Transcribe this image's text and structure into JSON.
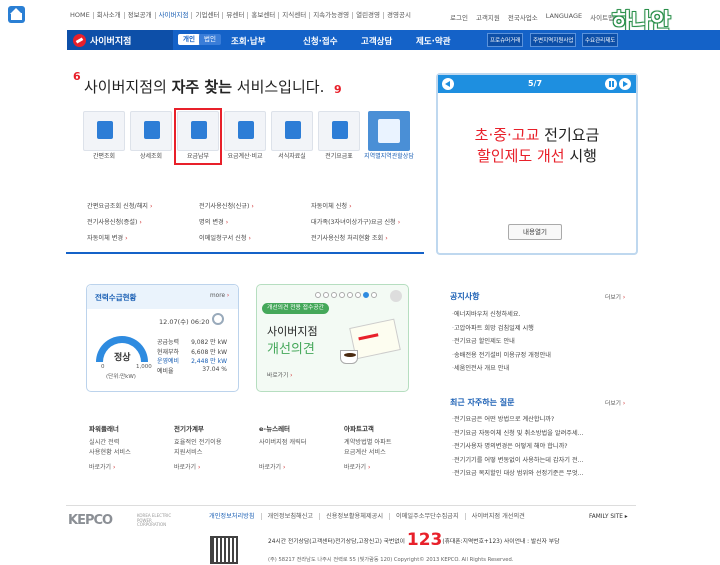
{
  "top_nav": [
    "HOME",
    "회사소개",
    "정보공개",
    "사이버지점",
    "기업센터",
    "뮤센터",
    "홍보센터",
    "지식센터",
    "지속가능경영",
    "열린경영",
    "경영공시"
  ],
  "top_nav_active": "사이버지점",
  "util_nav": [
    "로그인",
    "고객지원",
    "전국사업소",
    "LANGUAGE",
    "사이트맵"
  ],
  "brand_deco": "하나안",
  "gnb": {
    "title": "사이버지점",
    "personal": "개인",
    "corporate": "법인",
    "menu": [
      "조회·납부",
      "신청·접수",
      "고객상담",
      "제도·약관"
    ],
    "quick": [
      "프로슈머거래",
      "주변지역지원사업",
      "수요관리제도"
    ]
  },
  "frequent": {
    "title_prefix": "사이버지점의 ",
    "title_bold": "자주 찾는",
    "title_suffix": " 서비스입니다.",
    "deco_left": "6",
    "deco_right": "9",
    "services": [
      {
        "label": "간편조회",
        "icon": "bill-chart-icon",
        "color": "#2d7dd6"
      },
      {
        "label": "상세조회",
        "icon": "magnify-plus-icon",
        "color": "#2d7dd6"
      },
      {
        "label": "요금납부",
        "icon": "payment-book-icon",
        "color": "#2d7dd6"
      },
      {
        "label": "요금계산·비교",
        "icon": "calendar-calc-icon",
        "color": "#2d7dd6"
      },
      {
        "label": "서식자료실",
        "icon": "document-list-icon",
        "color": "#2d7dd6"
      },
      {
        "label": "전기요금표",
        "icon": "rate-table-icon",
        "color": "#2d7dd6"
      }
    ],
    "big_label": "지역별지역관할상담"
  },
  "quick_links": [
    [
      "간편요금조회 신청/해지",
      "전기사용신청(신규)",
      "자동이체 신청"
    ],
    [
      "전기사용신청(증설)",
      "명의 변경",
      "대가족(3자녀이상가구)요금 신청"
    ],
    [
      "자동이체 변경",
      "이메일청구서 신청",
      "전기사용신청 처리현황 조회"
    ]
  ],
  "promo": {
    "page": "5/7",
    "line1_red": "초·중·고교",
    "line1_rest": " 전기요금",
    "line2_red": "할인제도 개선",
    "line2_rest": " 시행",
    "button": "내용열기"
  },
  "power": {
    "title": "전력수급현황",
    "more": "more",
    "time": "12.07(수) 06:20",
    "state": "정상",
    "min": "0",
    "max": "1,000",
    "unit": "(단위:만kW)",
    "rows": [
      {
        "label": "공급능력",
        "value": "9,082 만 kW",
        "hl": false
      },
      {
        "label": "현재부하",
        "value": "6,608 만 kW",
        "hl": false
      },
      {
        "label": "운영예비",
        "value": "2,448 만 kW",
        "hl": true
      },
      {
        "label": "예비율",
        "value": "37.04 %",
        "hl": false
      }
    ]
  },
  "cyber_promo": {
    "pill": "개선의견 전용 접수공간",
    "title1": "사이버지점",
    "title2": "개선의견",
    "more": "바로가기"
  },
  "notices": {
    "title": "공지사항",
    "more": "더보기",
    "items": [
      "에너지바우처 신청하세요.",
      "고압아파트 희망 검침일제 시행",
      "전기요금 할인제도 안내",
      "송배전용 전기설비 이용규정 개정안내",
      "세움인전사 개요 안내"
    ]
  },
  "faq": {
    "title": "최근 자주하는 질문",
    "more": "더보기",
    "items": [
      "전기요금은 어떤 방법으로 계산합니까?",
      "전기요금 자동이체 신청 및 취소방법을 알려주세...",
      "전기사용자 명의변경은 어떻게 해야 합니까?",
      "전기기기를 어떻 변동없이 사용하는데 갑자기 전...",
      "전기요금 복지할인 대상 범위와 선정기준은 무엇..."
    ]
  },
  "columns": [
    {
      "title": "파워플래너",
      "desc": [
        "실시간 전력",
        "사용현황 서비스"
      ],
      "more": "바로가기"
    },
    {
      "title": "전기가계부",
      "desc": [
        "효율적인 전기이용",
        "지원서비스"
      ],
      "more": "바로가기"
    },
    {
      "title": "e-뉴스레터",
      "desc": [
        "사이버지점 캐릭터"
      ],
      "more": "바로가기"
    },
    {
      "title": "아파트고객",
      "desc": [
        "계약방법별 아파트",
        "요금계산 서비스"
      ],
      "more": "바로가기"
    }
  ],
  "footer": {
    "logo": "KEPCO",
    "logo_sub": "KOREA ELECTRIC POWER CORPORATION",
    "nav": [
      "개인정보처리방침",
      "개인정보침해신고",
      "신용정보활용체제공시",
      "이메일주소무단수집금지",
      "사이버지점 개선의견"
    ],
    "family": "FAMILY SITE",
    "contact_prefix": "24시간 전기상담(고객센터)전기상담,고장신고) 국번없이 ",
    "contact_num": "123",
    "contact_suffix": "(휴대폰:지역번호+123) 사이언내 : 발신자 부담",
    "addr": "(주) 58217 전라남도 나주시 전력로 55 (빛가람동 120)   Copyright© 2013 KEPCO. All Rights Reserved."
  }
}
